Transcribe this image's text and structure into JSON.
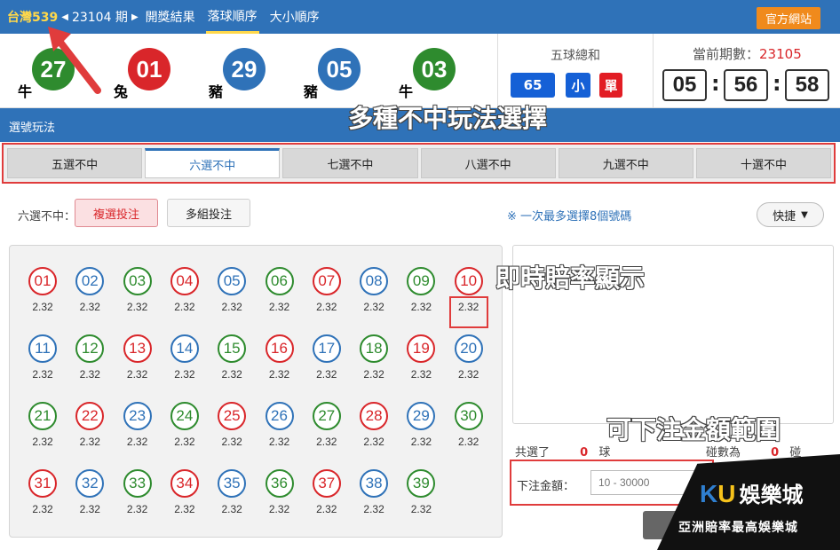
{
  "nav": {
    "lottery": "台灣539",
    "period": "23104 期",
    "links": [
      "開獎結果",
      "落球順序",
      "大小順序"
    ],
    "official": "官方網站"
  },
  "results": {
    "balls": [
      {
        "num": "27",
        "zodiac": "牛",
        "color": "#2e8b2e"
      },
      {
        "num": "01",
        "zodiac": "兔",
        "color": "#d9262a"
      },
      {
        "num": "29",
        "zodiac": "豬",
        "color": "#2f72b8"
      },
      {
        "num": "05",
        "zodiac": "豬",
        "color": "#2f72b8"
      },
      {
        "num": "03",
        "zodiac": "牛",
        "color": "#2e8b2e"
      }
    ],
    "sum_title": "五球總和",
    "sum_value": "65",
    "size": "小",
    "parity": "單",
    "period_label": "當前期數：",
    "period_value": "23105",
    "timer": [
      "05",
      "56",
      "58"
    ]
  },
  "section_title": "選號玩法",
  "tabs": [
    "五選不中",
    "六選不中",
    "七選不中",
    "八選不中",
    "九選不中",
    "十選不中"
  ],
  "mode": {
    "label": "六選不中：",
    "primary": "複選投注",
    "secondary": "多組投注",
    "hint": "※ 一次最多選擇8個號碼",
    "quick": "快捷"
  },
  "numbers": [
    {
      "n": "01",
      "c": "red"
    },
    {
      "n": "02",
      "c": "blue"
    },
    {
      "n": "03",
      "c": "green"
    },
    {
      "n": "04",
      "c": "red"
    },
    {
      "n": "05",
      "c": "blue"
    },
    {
      "n": "06",
      "c": "green"
    },
    {
      "n": "07",
      "c": "red"
    },
    {
      "n": "08",
      "c": "blue"
    },
    {
      "n": "09",
      "c": "green"
    },
    {
      "n": "10",
      "c": "red"
    },
    {
      "n": "11",
      "c": "blue"
    },
    {
      "n": "12",
      "c": "green"
    },
    {
      "n": "13",
      "c": "red"
    },
    {
      "n": "14",
      "c": "blue"
    },
    {
      "n": "15",
      "c": "green"
    },
    {
      "n": "16",
      "c": "red"
    },
    {
      "n": "17",
      "c": "blue"
    },
    {
      "n": "18",
      "c": "green"
    },
    {
      "n": "19",
      "c": "red"
    },
    {
      "n": "20",
      "c": "blue"
    },
    {
      "n": "21",
      "c": "green"
    },
    {
      "n": "22",
      "c": "red"
    },
    {
      "n": "23",
      "c": "blue"
    },
    {
      "n": "24",
      "c": "green"
    },
    {
      "n": "25",
      "c": "red"
    },
    {
      "n": "26",
      "c": "blue"
    },
    {
      "n": "27",
      "c": "green"
    },
    {
      "n": "28",
      "c": "red"
    },
    {
      "n": "29",
      "c": "blue"
    },
    {
      "n": "30",
      "c": "green"
    },
    {
      "n": "31",
      "c": "red"
    },
    {
      "n": "32",
      "c": "blue"
    },
    {
      "n": "33",
      "c": "green"
    },
    {
      "n": "34",
      "c": "red"
    },
    {
      "n": "35",
      "c": "blue"
    },
    {
      "n": "36",
      "c": "green"
    },
    {
      "n": "37",
      "c": "red"
    },
    {
      "n": "38",
      "c": "blue"
    },
    {
      "n": "39",
      "c": "green"
    }
  ],
  "odds_value": "2.32",
  "summary": {
    "selected_prefix": "共選了",
    "selected_count": "0",
    "selected_unit": "球",
    "combo_prefix": "碰數為",
    "combo_count": "0",
    "combo_unit": "碰"
  },
  "amount": {
    "label": "下注金額：",
    "placeholder": "10 - 30000"
  },
  "annotations": {
    "play_select": "多種不中玩法選擇",
    "odds_display": "即時賠率顯示",
    "bet_range": "可下注金額範圍"
  },
  "logo": {
    "k": "K",
    "u": "U",
    "name": "娛樂城",
    "tagline": "亞洲賠率最高娛樂城"
  }
}
